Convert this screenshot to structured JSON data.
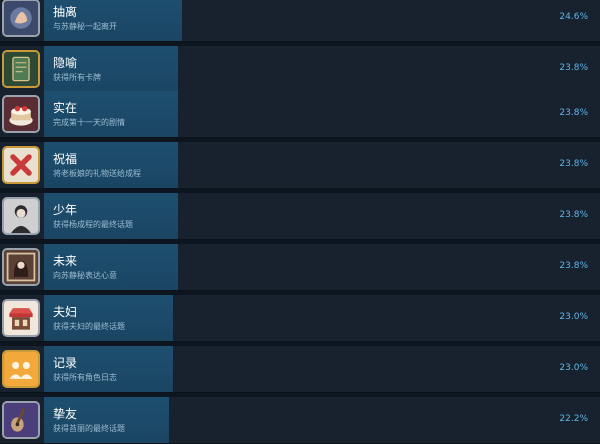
{
  "achievements": [
    {
      "title": "抽离",
      "desc": "与苏静秘一起离开",
      "percent_label": "24.6%",
      "percent": 24.6,
      "icon": "hand-icon",
      "frame": "silver"
    },
    {
      "title": "隐喻",
      "desc": "获得所有卡牌",
      "percent_label": "23.8%",
      "percent": 23.8,
      "icon": "card-icon",
      "frame": "gold"
    },
    {
      "title": "实在",
      "desc": "完成第十一天的剧情",
      "percent_label": "23.8%",
      "percent": 23.8,
      "icon": "cake-icon",
      "frame": "silver"
    },
    {
      "title": "祝福",
      "desc": "将老板娘的礼物送给成程",
      "percent_label": "23.8%",
      "percent": 23.8,
      "icon": "gift-icon",
      "frame": "gold"
    },
    {
      "title": "少年",
      "desc": "获得杨成程的最终话题",
      "percent_label": "23.8%",
      "percent": 23.8,
      "icon": "boy-portrait-icon",
      "frame": "silver"
    },
    {
      "title": "未来",
      "desc": "向苏静秘表达心意",
      "percent_label": "23.8%",
      "percent": 23.8,
      "icon": "girl-portrait-icon",
      "frame": "silver"
    },
    {
      "title": "夫妇",
      "desc": "获得夫妇的最终话题",
      "percent_label": "23.0%",
      "percent": 23.0,
      "icon": "shop-icon",
      "frame": "silver"
    },
    {
      "title": "记录",
      "desc": "获得所有角色日志",
      "percent_label": "23.0%",
      "percent": 23.0,
      "icon": "people-icon",
      "frame": "gold"
    },
    {
      "title": "挚友",
      "desc": "获得苔丽的最终话题",
      "percent_label": "22.2%",
      "percent": 22.2,
      "icon": "guitar-icon",
      "frame": "silver"
    }
  ]
}
